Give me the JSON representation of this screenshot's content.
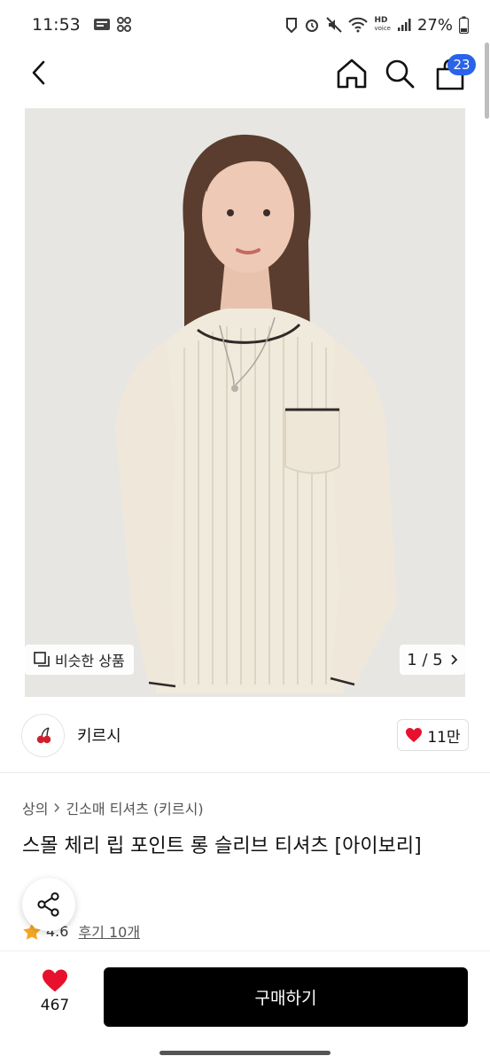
{
  "status_bar": {
    "time": "11:53",
    "battery_percent": "27%",
    "hd_label": "HD",
    "voice_label": "voice"
  },
  "header": {
    "cart_count": "23"
  },
  "gallery": {
    "similar_label": "비슷한 상품",
    "pager": "1 / 5"
  },
  "brand": {
    "name": "키르시",
    "likes": "11만"
  },
  "breadcrumb": {
    "category": "상의",
    "subcategory": "긴소매 티셔츠 (키르시)"
  },
  "product": {
    "title": "스몰 체리 립 포인트 롱 슬리브 티셔츠 [아이보리]",
    "rating": "4.6",
    "reviews": "후기 10개"
  },
  "bottom_bar": {
    "like_count": "467",
    "buy_label": "구매하기"
  },
  "colors": {
    "accent_badge": "#2a62e8",
    "heart": "#e8112d",
    "star": "#f5a623",
    "buy_button": "#000000"
  }
}
